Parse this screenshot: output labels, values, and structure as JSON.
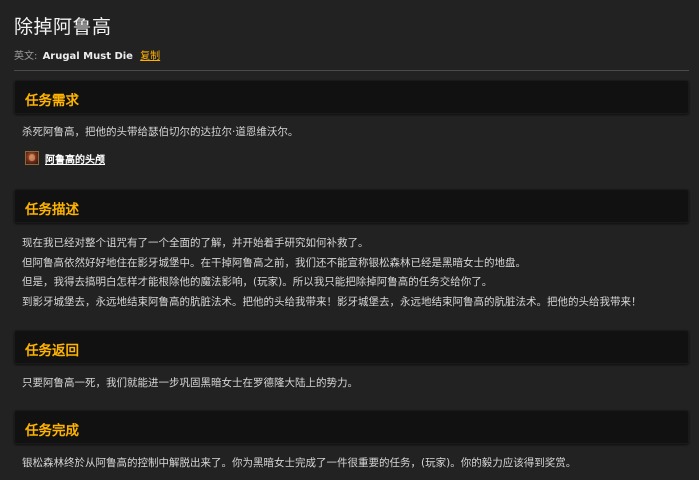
{
  "quest": {
    "title": "除掉阿鲁高",
    "english_label": "英文:",
    "english_name": "Arugal Must Die",
    "copy_label": "复制"
  },
  "sections": {
    "requirements": {
      "heading": "任务需求",
      "text": "杀死阿鲁高，把他的头带给瑟伯切尔的达拉尔·道恩维沃尔。",
      "item": {
        "icon": "arugal-head-icon",
        "label": "阿鲁高的头颅"
      }
    },
    "description": {
      "heading": "任务描述",
      "lines": [
        "现在我已经对整个诅咒有了一个全面的了解，并开始着手研究如何补救了。",
        "但阿鲁高依然好好地住在影牙城堡中。在干掉阿鲁高之前，我们还不能宣称银松森林已经是黑暗女士的地盘。",
        "但是，我得去搞明白怎样才能根除他的魔法影响，(玩家)。所以我只能把除掉阿鲁高的任务交给你了。",
        "到影牙城堡去，永远地结束阿鲁高的肮脏法术。把他的头给我带来！影牙城堡去，永远地结束阿鲁高的肮脏法术。把他的头给我带来！"
      ]
    },
    "return": {
      "heading": "任务返回",
      "text": "只要阿鲁高一死，我们就能进一步巩固黑暗女士在罗德隆大陆上的势力。"
    },
    "completion": {
      "heading": "任务完成",
      "text": "银松森林终於从阿鲁高的控制中解脱出来了。你为黑暗女士完成了一件很重要的任务，(玩家)。你的毅力应该得到奖赏。"
    }
  },
  "colors": {
    "background": "#222222",
    "header_bg": "#111111",
    "accent": "#ffb400",
    "text": "#d6d6d6"
  }
}
